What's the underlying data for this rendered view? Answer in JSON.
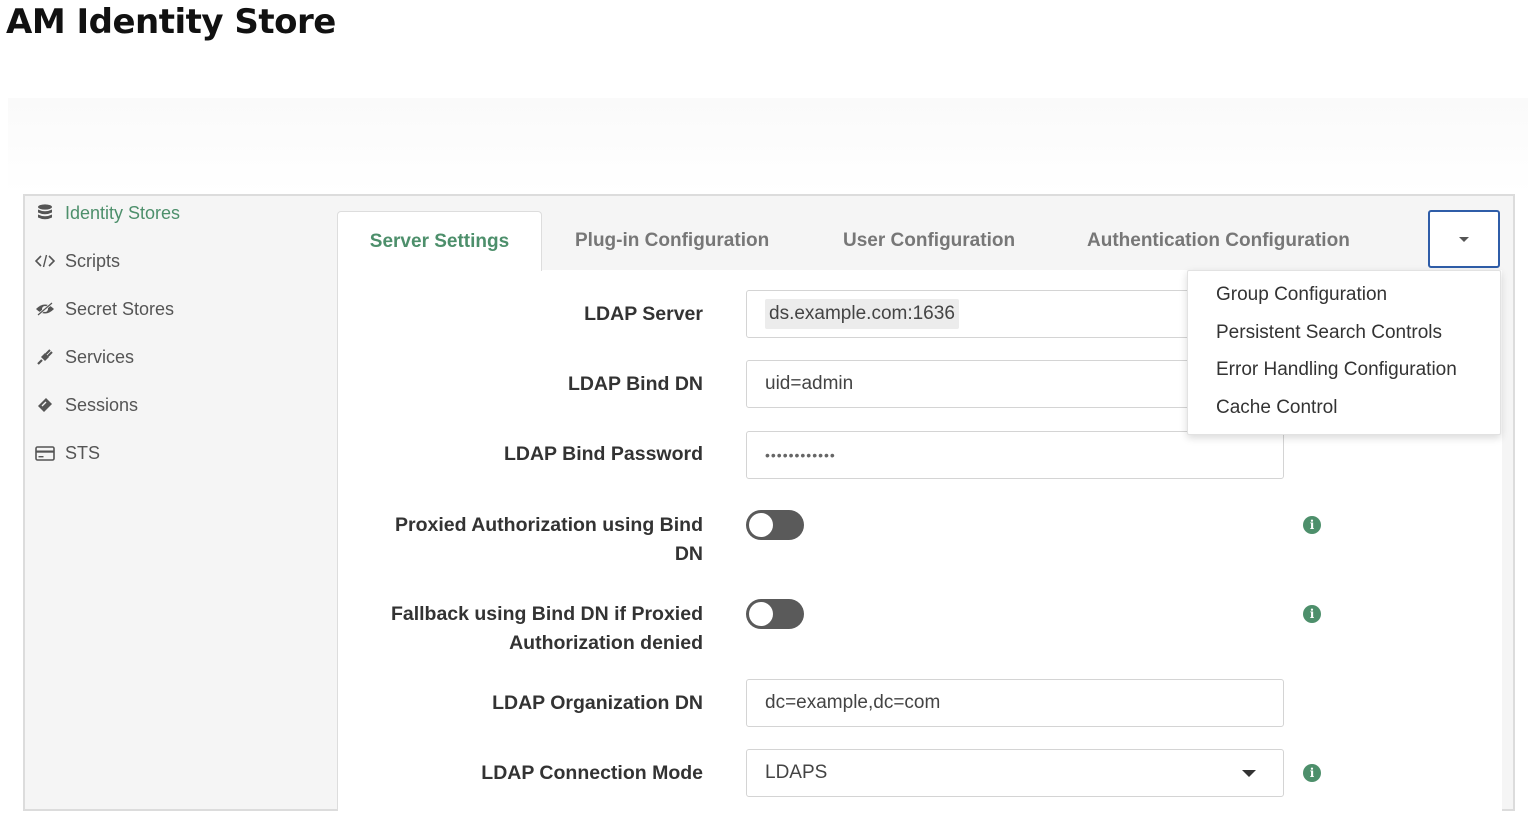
{
  "page": {
    "title": "AM Identity Store"
  },
  "sidebar": {
    "items": [
      {
        "label": "Identity Stores",
        "icon": "database-icon"
      },
      {
        "label": "Scripts",
        "icon": "code-icon"
      },
      {
        "label": "Secret Stores",
        "icon": "eye-slash-icon"
      },
      {
        "label": "Services",
        "icon": "plug-icon"
      },
      {
        "label": "Sessions",
        "icon": "ticket-icon"
      },
      {
        "label": "STS",
        "icon": "credit-card-icon"
      }
    ],
    "active": "Identity Stores"
  },
  "tabs": {
    "items": [
      {
        "label": "Server Settings"
      },
      {
        "label": "Plug-in Configuration"
      },
      {
        "label": "User Configuration"
      },
      {
        "label": "Authentication Configuration"
      }
    ],
    "active": "Server Settings"
  },
  "more_menu": {
    "items": [
      {
        "label": "Group Configuration"
      },
      {
        "label": "Persistent Search Controls"
      },
      {
        "label": "Error Handling Configuration"
      },
      {
        "label": "Cache Control"
      }
    ]
  },
  "form": {
    "ldap_server": {
      "label": "LDAP Server",
      "value": "ds.example.com:1636"
    },
    "ldap_bind_dn": {
      "label": "LDAP Bind DN",
      "value": "uid=admin"
    },
    "ldap_bind_password": {
      "label": "LDAP Bind Password",
      "value": "••••••••••••"
    },
    "proxied_auth": {
      "label_line1": "Proxied Authorization using Bind",
      "label_line2": "DN",
      "enabled": false
    },
    "fallback_bind": {
      "label_line1": "Fallback using Bind DN if Proxied",
      "label_line2": "Authorization denied",
      "enabled": false
    },
    "ldap_org_dn": {
      "label": "LDAP Organization DN",
      "value": "dc=example,dc=com"
    },
    "ldap_connection_mode": {
      "label": "LDAP Connection Mode",
      "value": "LDAPS"
    }
  },
  "colors": {
    "accent": "#4d8f6b",
    "focus_border": "#2f5da8",
    "toggle_off": "#5a5a5a"
  }
}
